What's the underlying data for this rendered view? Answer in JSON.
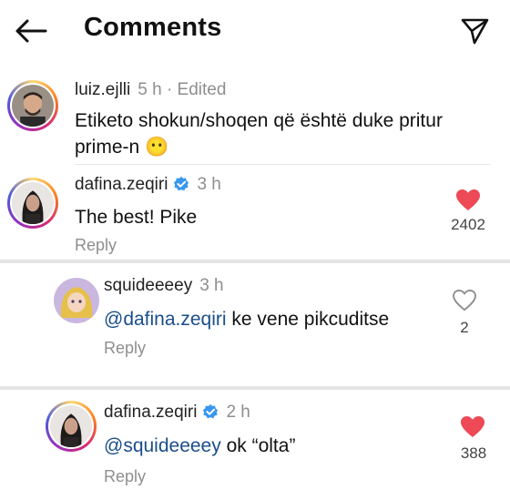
{
  "header": {
    "title": "Comments",
    "back_icon": "arrow-left-icon",
    "send_icon": "paper-plane-icon"
  },
  "comments": [
    {
      "username": "luiz.ejlli",
      "time": "5 h · Edited",
      "text": "Etiketo shokun/shoqen që është duke pritur",
      "text_line2": "prime-n 😶",
      "verified": false
    },
    {
      "username": "dafina.zeqiri",
      "time": "3 h",
      "text": "The best! Pike",
      "reply": "Reply",
      "likes": "2402",
      "liked": true,
      "verified": true
    },
    {
      "username": "squideeeey",
      "time": "3 h",
      "mention": "@dafina.zeqiri",
      "text": " ke vene pikcuditse",
      "reply": "Reply",
      "likes": "2",
      "liked": false
    },
    {
      "username": "dafina.zeqiri",
      "time": "2 h",
      "mention": "@squideeeey",
      "text": " ok “olta”",
      "reply": "Reply",
      "likes": "388",
      "liked": true,
      "verified": true
    }
  ],
  "colors": {
    "like_red": "#ed4956",
    "verified_blue": "#3897f0",
    "mention_blue": "#1a4e8a",
    "muted_gray": "#8e8e8e"
  }
}
